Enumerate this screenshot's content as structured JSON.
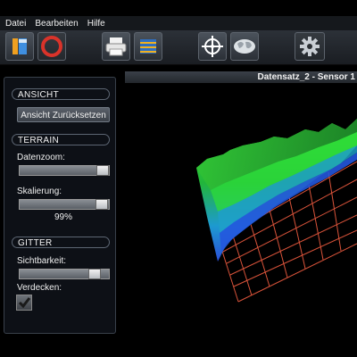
{
  "menu": {
    "items": [
      "Datei",
      "Bearbeiten",
      "Hilfe"
    ]
  },
  "toolbar": {
    "buttons": [
      "save-icon",
      "no-entry-icon",
      "printer-icon",
      "layers-icon",
      "crosshair-icon",
      "world-map-icon",
      "gear-icon"
    ]
  },
  "sidebar": {
    "ansicht": {
      "title": "ANSICHT",
      "reset_button": "Ansicht Zurücksetzen"
    },
    "terrain": {
      "title": "TERRAIN",
      "datenzoom_label": "Datenzoom:",
      "datenzoom_value": 1.0,
      "skalierung_label": "Skalierung:",
      "skalierung_value": 0.99,
      "skalierung_text": "99%"
    },
    "gitter": {
      "title": "GITTER",
      "sichtbarkeit_label": "Sichtbarkeit:",
      "sichtbarkeit_value": 0.9,
      "verdecken_label": "Verdecken:",
      "verdecken_checked": true
    }
  },
  "viewport": {
    "title": "Datensatz_2 - Sensor 1"
  },
  "colors": {
    "accent": "#d9533a",
    "terrain_green": "#2fd12a",
    "terrain_blue": "#2a5ee0"
  }
}
